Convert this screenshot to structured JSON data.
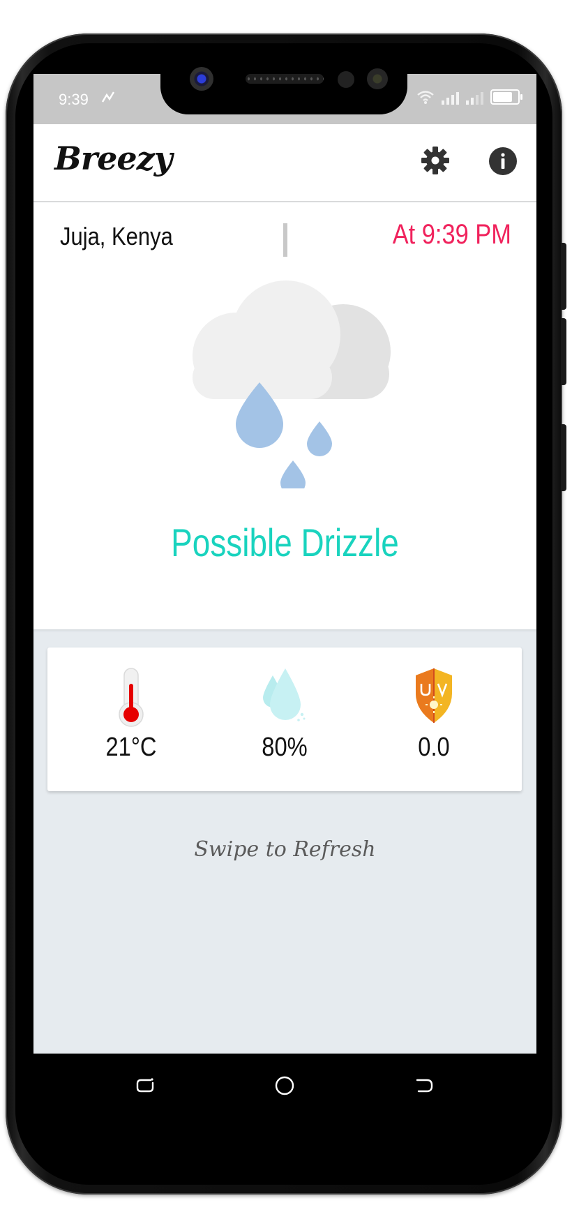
{
  "status_bar": {
    "time": "9:39"
  },
  "app_bar": {
    "title": "Breezy"
  },
  "location": {
    "name": "Juja, Kenya",
    "updated_at": "At 9:39 PM"
  },
  "weather": {
    "condition": "Possible Drizzle",
    "icon": "cloud-drizzle-icon"
  },
  "stats": [
    {
      "name": "temperature",
      "icon": "thermometer-icon",
      "value": "21°C"
    },
    {
      "name": "humidity",
      "icon": "water-drops-icon",
      "value": "80%"
    },
    {
      "name": "uv-index",
      "icon": "uv-shield-icon",
      "value": "0.0"
    }
  ],
  "hint": "Swipe to Refresh",
  "colors": {
    "accent_time": "#f0225c",
    "condition": "#19d3be",
    "background": "#e6ebef",
    "status_bar": "#c6c6c6"
  }
}
